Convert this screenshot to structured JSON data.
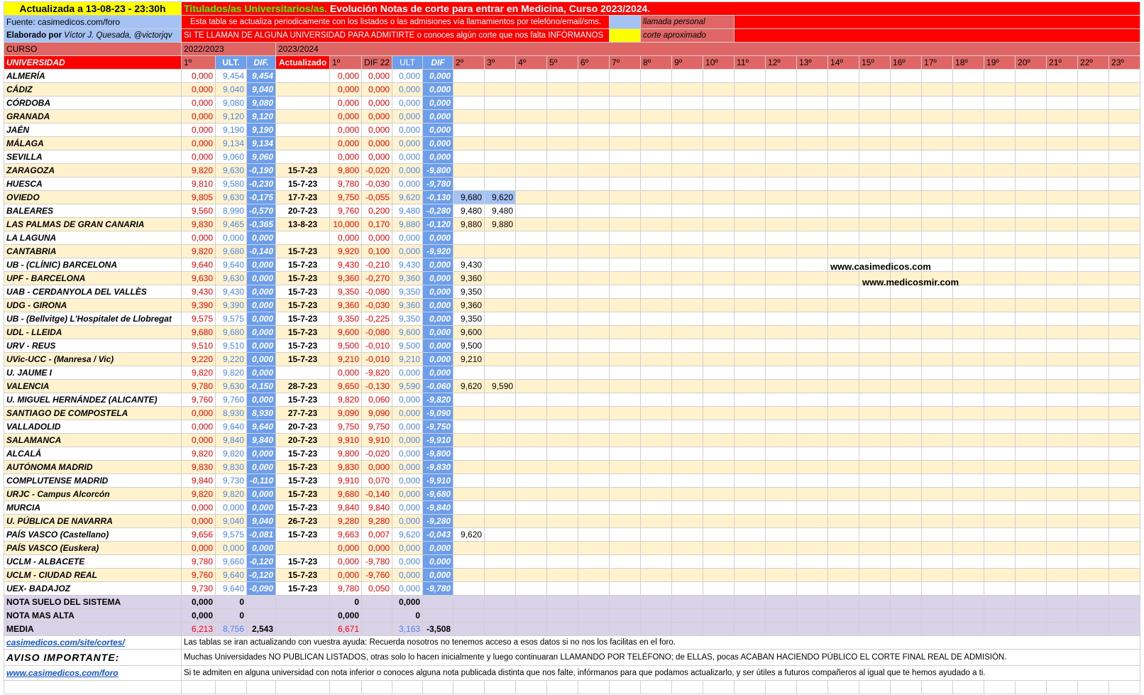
{
  "header": {
    "updated": "Actualizada a 13-08-23 - 23:30h",
    "title_a": "Titulados/as Universitarios/as.",
    "title_b": " Evolución Notas de corte para entrar en Medicina, Curso 2023/2024.",
    "source": "Fuente: casimedicos.com/foro",
    "elab_prefix": "Elaborado por ",
    "elab_name": "Víctor J. Quesada, @victorjqv",
    "note1": "Esta tabla se actualiza periodicamente con los listados o las admisiones vía llamamientos por telefóno/email/sms.",
    "note2": "SI TE LLAMAN DE ALGUNA UNIVERSIDAD PARA ADMITIRTE o conoces algún corte que nos falta INFÓRMANOS",
    "legend1": "llamada personal",
    "legend2": "corte aproximado",
    "legend1_color": "#a4c2f4",
    "legend2_color": "#ffff00"
  },
  "curso": {
    "label": "CURSO",
    "y1": "2022/2023",
    "y2": "2023/2024"
  },
  "cols": {
    "uni": "UNIVERSIDAD",
    "p1": "1º",
    "ult": "ULT.",
    "dif": "DIF.",
    "act": "Actualizado",
    "p1b": "1º",
    "dif22": "DIF 22",
    "ultb": "ULT",
    "difb": "DIF",
    "calls": [
      "2º",
      "3º",
      "4º",
      "5º",
      "6º",
      "7º",
      "8º",
      "9º",
      "10º",
      "11º",
      "12º",
      "13º",
      "14º",
      "15º",
      "16º",
      "17º",
      "18º",
      "19º",
      "20º",
      "21º",
      "22º",
      "23º"
    ]
  },
  "rows": [
    {
      "u": "ALMERÍA",
      "a": "0,000",
      "b": "9,454",
      "c": "9,454",
      "d": "",
      "e": "0,000",
      "f": "0,000",
      "g": "0,000",
      "h": "0,000",
      "calls": []
    },
    {
      "u": "CÁDIZ",
      "a": "0,000",
      "b": "9,040",
      "c": "9,040",
      "d": "",
      "e": "0,000",
      "f": "0,000",
      "g": "0,000",
      "h": "0,000",
      "calls": []
    },
    {
      "u": "CÓRDOBA",
      "a": "0,000",
      "b": "9,080",
      "c": "9,080",
      "d": "",
      "e": "0,000",
      "f": "0,000",
      "g": "0,000",
      "h": "0,000",
      "calls": []
    },
    {
      "u": "GRANADA",
      "a": "0,000",
      "b": "9,120",
      "c": "9,120",
      "d": "",
      "e": "0,000",
      "f": "0,000",
      "g": "0,000",
      "h": "0,000",
      "calls": []
    },
    {
      "u": "JAÉN",
      "a": "0,000",
      "b": "9,190",
      "c": "9,190",
      "d": "",
      "e": "0,000",
      "f": "0,000",
      "g": "0,000",
      "h": "0,000",
      "calls": []
    },
    {
      "u": "MÁLAGA",
      "a": "0,000",
      "b": "9,134",
      "c": "9,134",
      "d": "",
      "e": "0,000",
      "f": "0,000",
      "g": "0,000",
      "h": "0,000",
      "calls": []
    },
    {
      "u": "SEVILLA",
      "a": "0,000",
      "b": "9,060",
      "c": "9,060",
      "d": "",
      "e": "0,000",
      "f": "0,000",
      "g": "0,000",
      "h": "0,000",
      "calls": []
    },
    {
      "u": "ZARAGOZA",
      "a": "9,820",
      "b": "9,630",
      "c": "-0,190",
      "d": "15-7-23",
      "e": "9,800",
      "f": "-0,020",
      "g": "0,000",
      "h": "-9,800",
      "calls": []
    },
    {
      "u": "HUESCA",
      "a": "9,810",
      "b": "9,580",
      "c": "-0,230",
      "d": "15-7-23",
      "e": "9,780",
      "f": "-0,030",
      "g": "0,000",
      "h": "-9,780",
      "calls": []
    },
    {
      "u": "OVIEDO",
      "a": "9,805",
      "b": "9,630",
      "c": "-0,175",
      "d": "17-7-23",
      "e": "9,750",
      "f": "-0,055",
      "g": "9,620",
      "h": "-0,130",
      "calls": [
        "9,680",
        "9,620"
      ],
      "hl": true
    },
    {
      "u": "BALEARES",
      "a": "9,560",
      "b": "8,990",
      "c": "-0,570",
      "d": "20-7-23",
      "e": "9,760",
      "f": "0,200",
      "g": "9,480",
      "h": "-0,280",
      "calls": [
        "9,480",
        "9,480"
      ]
    },
    {
      "u": "LAS PALMAS DE GRAN CANARIA",
      "a": "9,830",
      "b": "9,465",
      "c": "-0,365",
      "d": "13-8-23",
      "e": "10,000",
      "f": "0,170",
      "g": "9,880",
      "h": "-0,120",
      "calls": [
        "9,880",
        "9,880"
      ]
    },
    {
      "u": "LA LAGUNA",
      "a": "0,000",
      "b": "0,000",
      "c": "0,000",
      "d": "",
      "e": "0,000",
      "f": "0,000",
      "g": "0,000",
      "h": "0,000",
      "calls": []
    },
    {
      "u": "CANTABRIA",
      "a": "9,820",
      "b": "9,680",
      "c": "-0,140",
      "d": "15-7-23",
      "e": "9,920",
      "f": "0,100",
      "g": "0,000",
      "h": "-9,920",
      "calls": []
    },
    {
      "u": "UB - (CLÍNIC) BARCELONA",
      "a": "9,640",
      "b": "9,640",
      "c": "0,000",
      "d": "15-7-23",
      "e": "9,430",
      "f": "-0,210",
      "g": "9,430",
      "h": "0,000",
      "calls": [
        "9,430"
      ]
    },
    {
      "u": "UPF - BARCELONA",
      "a": "9,630",
      "b": "9,630",
      "c": "0,000",
      "d": "15-7-23",
      "e": "9,360",
      "f": "-0,270",
      "g": "9,360",
      "h": "0,000",
      "calls": [
        "9,360"
      ]
    },
    {
      "u": "UAB - CERDANYOLA DEL VALLÈS",
      "a": "9,430",
      "b": "9,430",
      "c": "0,000",
      "d": "15-7-23",
      "e": "9,350",
      "f": "-0,080",
      "g": "9,350",
      "h": "0,000",
      "calls": [
        "9,350"
      ]
    },
    {
      "u": "UDG - GIRONA",
      "a": "9,390",
      "b": "9,390",
      "c": "0,000",
      "d": "15-7-23",
      "e": "9,360",
      "f": "-0,030",
      "g": "9,360",
      "h": "0,000",
      "calls": [
        "9,360"
      ]
    },
    {
      "u": "UB - (Bellvitge) L'Hospitalet de Llobregat",
      "a": "9,575",
      "b": "9,575",
      "c": "0,000",
      "d": "15-7-23",
      "e": "9,350",
      "f": "-0,225",
      "g": "9,350",
      "h": "0,000",
      "calls": [
        "9,350"
      ]
    },
    {
      "u": "UDL - LLEIDA",
      "a": "9,680",
      "b": "9,680",
      "c": "0,000",
      "d": "15-7-23",
      "e": "9,600",
      "f": "-0,080",
      "g": "9,600",
      "h": "0,000",
      "calls": [
        "9,600"
      ]
    },
    {
      "u": "URV - REUS",
      "a": "9,510",
      "b": "9,510",
      "c": "0,000",
      "d": "15-7-23",
      "e": "9,500",
      "f": "-0,010",
      "g": "9,500",
      "h": "0,000",
      "calls": [
        "9,500"
      ]
    },
    {
      "u": "UVic-UCC - (Manresa / Vic)",
      "a": "9,220",
      "b": "9,220",
      "c": "0,000",
      "d": "15-7-23",
      "e": "9,210",
      "f": "-0,010",
      "g": "9,210",
      "h": "0,000",
      "calls": [
        "9,210"
      ]
    },
    {
      "u": "U. JAUME I",
      "a": "9,820",
      "b": "9,820",
      "c": "0,000",
      "d": "",
      "e": "0,000",
      "f": "-9,820",
      "g": "0,000",
      "h": "0,000",
      "calls": []
    },
    {
      "u": "VALENCIA",
      "a": "9,780",
      "b": "9,630",
      "c": "-0,150",
      "d": "28-7-23",
      "e": "9,650",
      "f": "-0,130",
      "g": "9,590",
      "h": "-0,060",
      "calls": [
        "9,620",
        "9,590"
      ]
    },
    {
      "u": "U. MIGUEL HERNÁNDEZ (ALICANTE)",
      "a": "9,760",
      "b": "9,760",
      "c": "0,000",
      "d": "15-7-23",
      "e": "9,820",
      "f": "0,060",
      "g": "0,000",
      "h": "-9,820",
      "calls": []
    },
    {
      "u": "SANTIAGO DE COMPOSTELA",
      "a": "0,000",
      "b": "8,930",
      "c": "8,930",
      "d": "27-7-23",
      "e": "9,090",
      "f": "9,090",
      "g": "0,000",
      "h": "-9,090",
      "calls": []
    },
    {
      "u": "VALLADOLID",
      "a": "0,000",
      "b": "9,640",
      "c": "9,640",
      "d": "20-7-23",
      "e": "9,750",
      "f": "9,750",
      "g": "0,000",
      "h": "-9,750",
      "calls": []
    },
    {
      "u": "SALAMANCA",
      "a": "0,000",
      "b": "9,840",
      "c": "9,840",
      "d": "20-7-23",
      "e": "9,910",
      "f": "9,910",
      "g": "0,000",
      "h": "-9,910",
      "calls": []
    },
    {
      "u": "ALCALÁ",
      "a": "9,820",
      "b": "9,820",
      "c": "0,000",
      "d": "15-7-23",
      "e": "9,800",
      "f": "-0,020",
      "g": "0,000",
      "h": "-9,800",
      "calls": []
    },
    {
      "u": "AUTÓNOMA MADRID",
      "a": "9,830",
      "b": "9,830",
      "c": "0,000",
      "d": "15-7-23",
      "e": "9,830",
      "f": "0,000",
      "g": "0,000",
      "h": "-9,830",
      "calls": []
    },
    {
      "u": "COMPLUTENSE MADRID",
      "a": "9,840",
      "b": "9,730",
      "c": "-0,110",
      "d": "15-7-23",
      "e": "9,910",
      "f": "0,070",
      "g": "0,000",
      "h": "-9,910",
      "calls": []
    },
    {
      "u": "URJC - Campus Alcorcón",
      "a": "9,820",
      "b": "9,820",
      "c": "0,000",
      "d": "15-7-23",
      "e": "9,680",
      "f": "-0,140",
      "g": "0,000",
      "h": "-9,680",
      "calls": []
    },
    {
      "u": "MURCIA",
      "a": "0,000",
      "b": "0,000",
      "c": "0,000",
      "d": "15-7-23",
      "e": "9,840",
      "f": "9,840",
      "g": "0,000",
      "h": "-9,840",
      "calls": []
    },
    {
      "u": "U. PÚBLICA DE NAVARRA",
      "a": "0,000",
      "b": "9,040",
      "c": "9,040",
      "d": "26-7-23",
      "e": "9,280",
      "f": "9,280",
      "g": "0,000",
      "h": "-9,280",
      "calls": []
    },
    {
      "u": "PAÍS VASCO (Castellano)",
      "a": "9,656",
      "b": "9,575",
      "c": "-0,081",
      "d": "15-7-23",
      "e": "9,663",
      "f": "0,007",
      "g": "9,620",
      "h": "-0,043",
      "calls": [
        "9,620"
      ]
    },
    {
      "u": "PAÍS VASCO (Euskera)",
      "a": "0,000",
      "b": "0,000",
      "c": "0,000",
      "d": "",
      "e": "0,000",
      "f": "0,000",
      "g": "0,000",
      "h": "0,000",
      "calls": []
    },
    {
      "u": "UCLM - ALBACETE",
      "a": "9,780",
      "b": "9,660",
      "c": "-0,120",
      "d": "15-7-23",
      "e": "0,000",
      "f": "-9,780",
      "g": "0,000",
      "h": "0,000",
      "calls": []
    },
    {
      "u": "UCLM - CIUDAD REAL",
      "a": "9,760",
      "b": "9,640",
      "c": "-0,120",
      "d": "15-7-23",
      "e": "0,000",
      "f": "-9,760",
      "g": "0,000",
      "h": "0,000",
      "calls": []
    },
    {
      "u": "UEX- BADAJOZ",
      "a": "9,730",
      "b": "9,640",
      "c": "-0,090",
      "d": "15-7-23",
      "e": "9,780",
      "f": "0,050",
      "g": "0,000",
      "h": "-9,780",
      "calls": []
    }
  ],
  "summary": {
    "suelo": {
      "label": "NOTA SUELO DEL SISTEMA",
      "a": "0,000",
      "b": "0",
      "e": "0",
      "g": "0,000"
    },
    "alta": {
      "label": "NOTA MAS ALTA",
      "a": "0,000",
      "b": "0",
      "e": "0,000",
      "g": "0"
    },
    "media": {
      "label": "MEDIA",
      "a": "6,213",
      "b": "8,756",
      "c": "2,543",
      "e": "6,671",
      "g": "3,163",
      "h": "-3,508"
    }
  },
  "footer": {
    "link1": "casimedicos.com/site/cortes/",
    "text1": "Las tablas se iran actualizando con vuestra ayuda: Recuerda nosotros no tenemos acceso a esos datos si no nos los facilitas en el foro.",
    "aviso": "AVISO IMPORTANTE:",
    "text2": "Muchas Universidades NO PUBLICAN LISTADOS, otras solo lo hacen inicialmente y luego continuaran LLAMANDO POR TELÉFONO; de ELLAS, pocas ACABAN HACIENDO PÚBLICO EL CORTE FINAL REAL DE ADMISIÓN.",
    "link2": "www.casimedicos.com/foro",
    "text3": "Si te admiten en alguna universidad con nota inferior o conoces alguna nota publicada distinta que nos falte, infórmanos para que podamos actualizarlo, y ser útiles a futuros compañeros al igual que te hemos ayudado a ti."
  },
  "overlay": {
    "url1": "www.casimedicos.com",
    "url2": "www.medicosmir.com"
  }
}
